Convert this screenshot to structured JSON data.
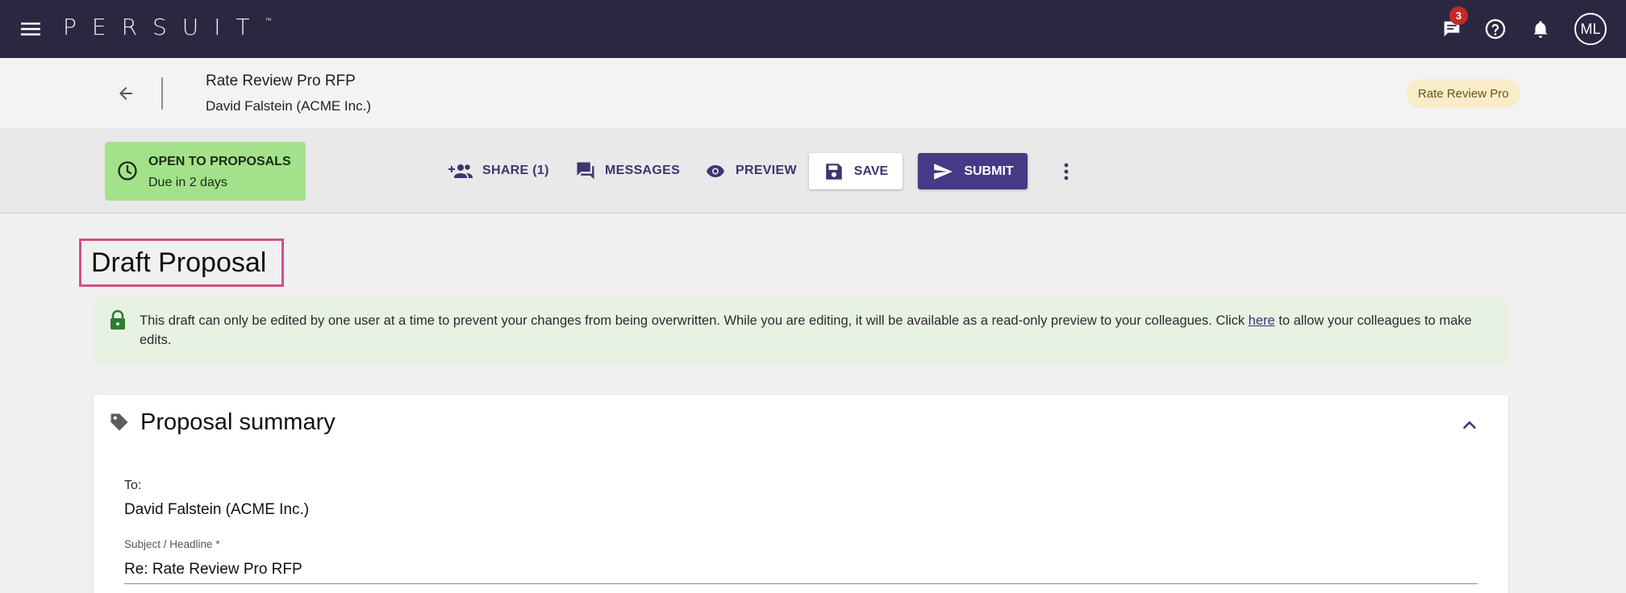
{
  "app": {
    "logo_text": "PERSUIT",
    "logo_mark": "™",
    "messages_badge": "3",
    "avatar_initials": "ML"
  },
  "header": {
    "rfp_title": "Rate Review Pro RFP",
    "client": "David Falstein (ACME Inc.)",
    "product_chip": "Rate Review Pro"
  },
  "status": {
    "title": "OPEN TO PROPOSALS",
    "due": "Due in 2 days",
    "color": "#a3e28a"
  },
  "actions": {
    "share": "SHARE (1)",
    "messages": "MESSAGES",
    "preview": "PREVIEW",
    "save": "SAVE",
    "submit": "SUBMIT"
  },
  "page": {
    "title": "Draft Proposal"
  },
  "notice": {
    "text_before": "This draft can only be edited by one user at a time to prevent your changes from being overwritten. While you are editing, it will be available as a read-only preview to your colleagues. Click ",
    "link": "here",
    "text_after": " to allow your colleagues to make edits."
  },
  "summary": {
    "title": "Proposal summary",
    "to_label": "To:",
    "to_value": "David Falstein (ACME Inc.)",
    "subject_label": "Subject / Headline *",
    "subject_value": "Re: Rate Review Pro RFP"
  },
  "colors": {
    "topbar": "#2a2740",
    "accent": "#453a86",
    "badge": "#c62828",
    "highlight_border": "#d94d86"
  }
}
